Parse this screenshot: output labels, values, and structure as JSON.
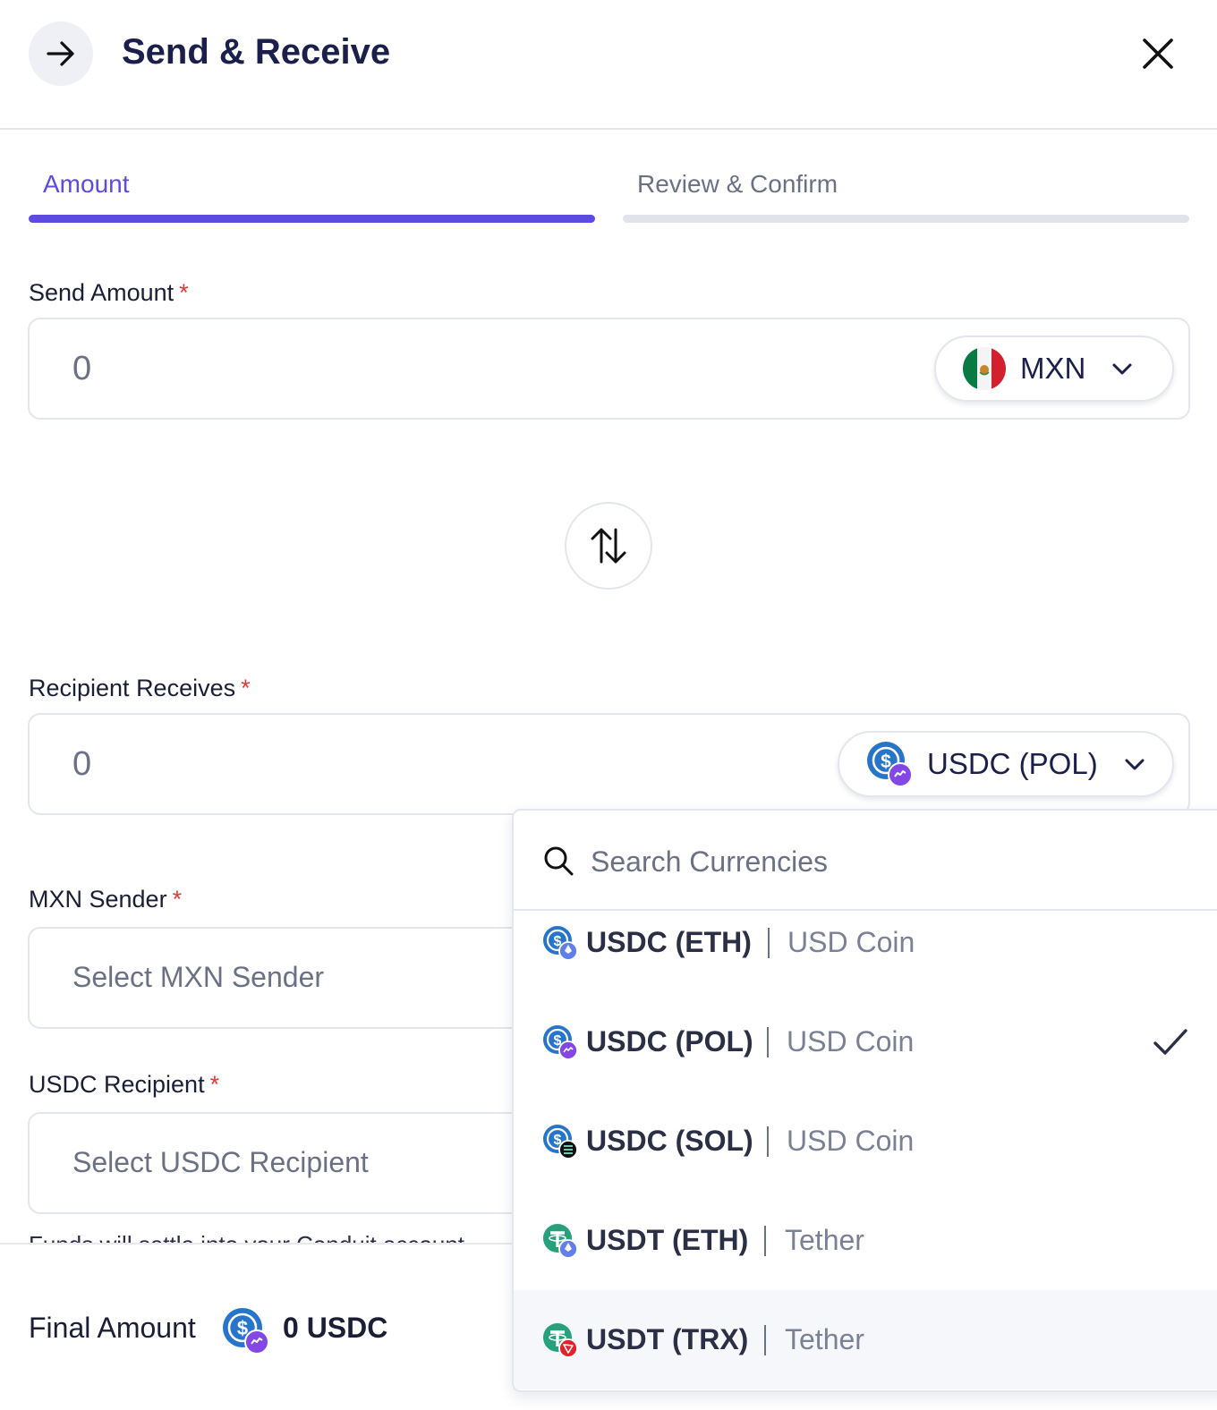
{
  "header": {
    "title": "Send & Receive",
    "back_icon": "arrow-right-icon",
    "close_icon": "close-icon"
  },
  "tabs": [
    {
      "label": "Amount",
      "active": true
    },
    {
      "label": "Review & Confirm",
      "active": false
    }
  ],
  "send": {
    "label": "Send Amount",
    "required_mark": "*",
    "value": "0",
    "currency": "MXN",
    "currency_icon": "mexico-flag-icon"
  },
  "swap_icon": "swap-arrows-icon",
  "receive": {
    "label": "Recipient Receives",
    "required_mark": "*",
    "value": "0",
    "currency": "USDC (POL)",
    "currency_icon": "usdc-polygon-icon"
  },
  "sender": {
    "label": "MXN Sender",
    "required_mark": "*",
    "placeholder": "Select MXN Sender"
  },
  "recipient": {
    "label": "USDC Recipient",
    "required_mark": "*",
    "placeholder": "Select USDC Recipient"
  },
  "note": "Funds will settle into your Conduit account",
  "final": {
    "label": "Final Amount",
    "value": "0 USDC"
  },
  "dropdown": {
    "search_placeholder": "Search Currencies",
    "items": [
      {
        "code": "USDC (ETH)",
        "name": "USD Coin",
        "icon": "usdc-ethereum-icon",
        "selected": false
      },
      {
        "code": "USDC (POL)",
        "name": "USD Coin",
        "icon": "usdc-polygon-icon",
        "selected": true
      },
      {
        "code": "USDC (SOL)",
        "name": "USD Coin",
        "icon": "usdc-solana-icon",
        "selected": false
      },
      {
        "code": "USDT (ETH)",
        "name": "Tether",
        "icon": "usdt-ethereum-icon",
        "selected": false
      },
      {
        "code": "USDT (TRX)",
        "name": "Tether",
        "icon": "usdt-tron-icon",
        "selected": false
      }
    ]
  },
  "colors": {
    "accent": "#5b4be0",
    "usdc_blue": "#2775ca",
    "polygon_purple": "#8247e5",
    "tether_green": "#26a17b",
    "tron_red": "#e5202b",
    "required_red": "#e53935"
  }
}
